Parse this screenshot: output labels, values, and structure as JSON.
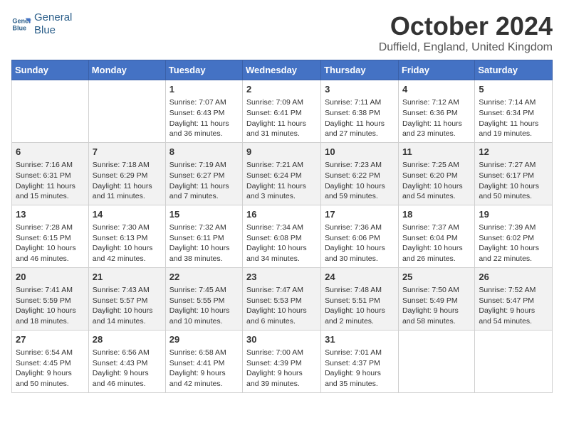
{
  "logo": {
    "line1": "General",
    "line2": "Blue"
  },
  "title": "October 2024",
  "location": "Duffield, England, United Kingdom",
  "days_of_week": [
    "Sunday",
    "Monday",
    "Tuesday",
    "Wednesday",
    "Thursday",
    "Friday",
    "Saturday"
  ],
  "weeks": [
    [
      {
        "day": "",
        "info": ""
      },
      {
        "day": "",
        "info": ""
      },
      {
        "day": "1",
        "info": "Sunrise: 7:07 AM\nSunset: 6:43 PM\nDaylight: 11 hours and 36 minutes."
      },
      {
        "day": "2",
        "info": "Sunrise: 7:09 AM\nSunset: 6:41 PM\nDaylight: 11 hours and 31 minutes."
      },
      {
        "day": "3",
        "info": "Sunrise: 7:11 AM\nSunset: 6:38 PM\nDaylight: 11 hours and 27 minutes."
      },
      {
        "day": "4",
        "info": "Sunrise: 7:12 AM\nSunset: 6:36 PM\nDaylight: 11 hours and 23 minutes."
      },
      {
        "day": "5",
        "info": "Sunrise: 7:14 AM\nSunset: 6:34 PM\nDaylight: 11 hours and 19 minutes."
      }
    ],
    [
      {
        "day": "6",
        "info": "Sunrise: 7:16 AM\nSunset: 6:31 PM\nDaylight: 11 hours and 15 minutes."
      },
      {
        "day": "7",
        "info": "Sunrise: 7:18 AM\nSunset: 6:29 PM\nDaylight: 11 hours and 11 minutes."
      },
      {
        "day": "8",
        "info": "Sunrise: 7:19 AM\nSunset: 6:27 PM\nDaylight: 11 hours and 7 minutes."
      },
      {
        "day": "9",
        "info": "Sunrise: 7:21 AM\nSunset: 6:24 PM\nDaylight: 11 hours and 3 minutes."
      },
      {
        "day": "10",
        "info": "Sunrise: 7:23 AM\nSunset: 6:22 PM\nDaylight: 10 hours and 59 minutes."
      },
      {
        "day": "11",
        "info": "Sunrise: 7:25 AM\nSunset: 6:20 PM\nDaylight: 10 hours and 54 minutes."
      },
      {
        "day": "12",
        "info": "Sunrise: 7:27 AM\nSunset: 6:17 PM\nDaylight: 10 hours and 50 minutes."
      }
    ],
    [
      {
        "day": "13",
        "info": "Sunrise: 7:28 AM\nSunset: 6:15 PM\nDaylight: 10 hours and 46 minutes."
      },
      {
        "day": "14",
        "info": "Sunrise: 7:30 AM\nSunset: 6:13 PM\nDaylight: 10 hours and 42 minutes."
      },
      {
        "day": "15",
        "info": "Sunrise: 7:32 AM\nSunset: 6:11 PM\nDaylight: 10 hours and 38 minutes."
      },
      {
        "day": "16",
        "info": "Sunrise: 7:34 AM\nSunset: 6:08 PM\nDaylight: 10 hours and 34 minutes."
      },
      {
        "day": "17",
        "info": "Sunrise: 7:36 AM\nSunset: 6:06 PM\nDaylight: 10 hours and 30 minutes."
      },
      {
        "day": "18",
        "info": "Sunrise: 7:37 AM\nSunset: 6:04 PM\nDaylight: 10 hours and 26 minutes."
      },
      {
        "day": "19",
        "info": "Sunrise: 7:39 AM\nSunset: 6:02 PM\nDaylight: 10 hours and 22 minutes."
      }
    ],
    [
      {
        "day": "20",
        "info": "Sunrise: 7:41 AM\nSunset: 5:59 PM\nDaylight: 10 hours and 18 minutes."
      },
      {
        "day": "21",
        "info": "Sunrise: 7:43 AM\nSunset: 5:57 PM\nDaylight: 10 hours and 14 minutes."
      },
      {
        "day": "22",
        "info": "Sunrise: 7:45 AM\nSunset: 5:55 PM\nDaylight: 10 hours and 10 minutes."
      },
      {
        "day": "23",
        "info": "Sunrise: 7:47 AM\nSunset: 5:53 PM\nDaylight: 10 hours and 6 minutes."
      },
      {
        "day": "24",
        "info": "Sunrise: 7:48 AM\nSunset: 5:51 PM\nDaylight: 10 hours and 2 minutes."
      },
      {
        "day": "25",
        "info": "Sunrise: 7:50 AM\nSunset: 5:49 PM\nDaylight: 9 hours and 58 minutes."
      },
      {
        "day": "26",
        "info": "Sunrise: 7:52 AM\nSunset: 5:47 PM\nDaylight: 9 hours and 54 minutes."
      }
    ],
    [
      {
        "day": "27",
        "info": "Sunrise: 6:54 AM\nSunset: 4:45 PM\nDaylight: 9 hours and 50 minutes."
      },
      {
        "day": "28",
        "info": "Sunrise: 6:56 AM\nSunset: 4:43 PM\nDaylight: 9 hours and 46 minutes."
      },
      {
        "day": "29",
        "info": "Sunrise: 6:58 AM\nSunset: 4:41 PM\nDaylight: 9 hours and 42 minutes."
      },
      {
        "day": "30",
        "info": "Sunrise: 7:00 AM\nSunset: 4:39 PM\nDaylight: 9 hours and 39 minutes."
      },
      {
        "day": "31",
        "info": "Sunrise: 7:01 AM\nSunset: 4:37 PM\nDaylight: 9 hours and 35 minutes."
      },
      {
        "day": "",
        "info": ""
      },
      {
        "day": "",
        "info": ""
      }
    ]
  ]
}
